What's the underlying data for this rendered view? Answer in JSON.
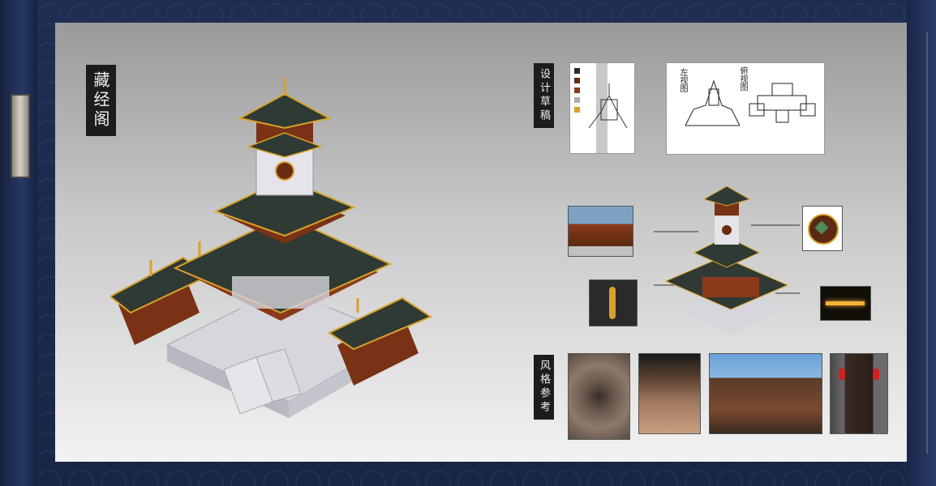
{
  "main_title": "藏经阁",
  "design_sketch_label": "设计草稿",
  "style_reference_label": "风格参考",
  "sketch_views": {
    "left": "左视图",
    "right": "俯视图"
  },
  "palette": [
    "#2a2a2a",
    "#6b2a12",
    "#8a3a1a",
    "#b0b0b0",
    "#d9a12a"
  ],
  "colors": {
    "frame": "#1f2d52",
    "roof": "#2f3a34",
    "wood": "#7a3216",
    "gold": "#d9a12a",
    "stone": "#d6d6dc"
  }
}
